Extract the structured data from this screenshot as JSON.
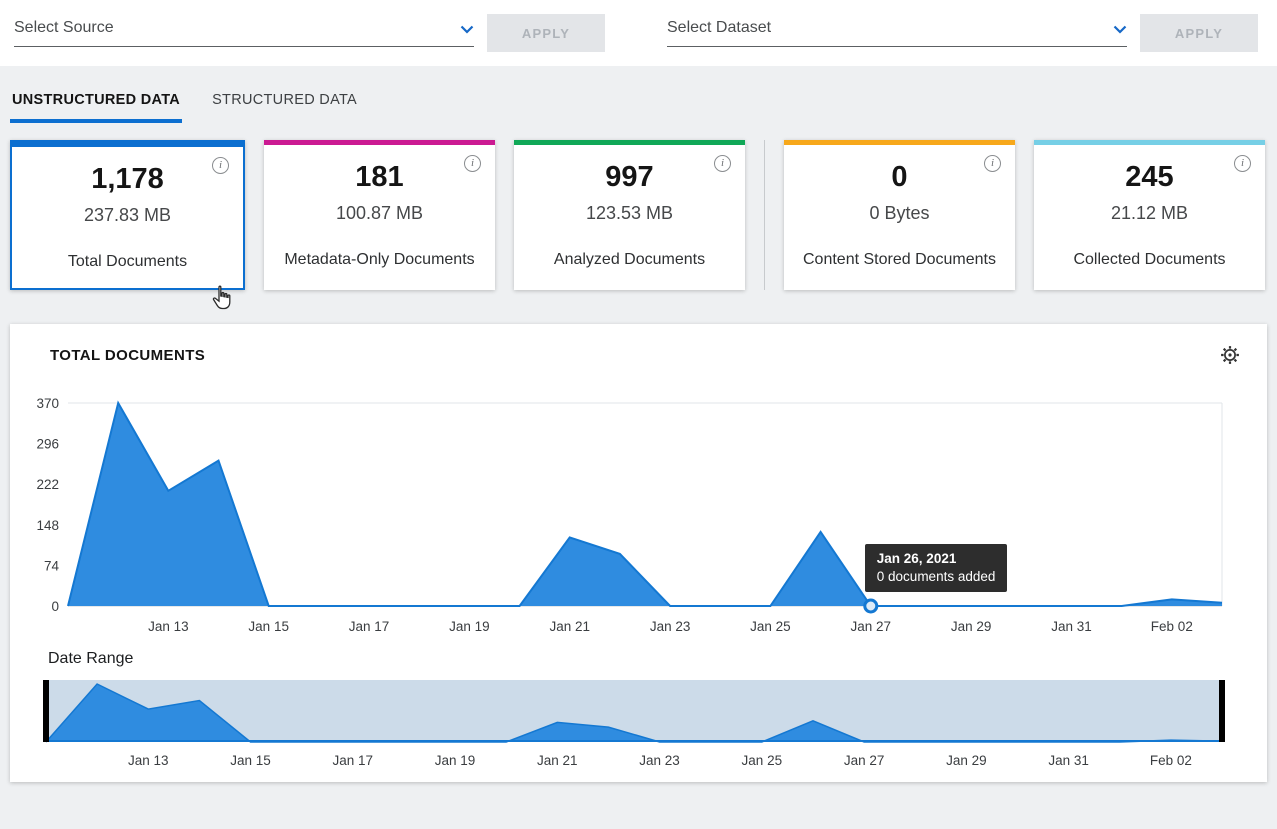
{
  "topbar": {
    "source_select": {
      "label": "Select Source"
    },
    "dataset_select": {
      "label": "Select Dataset"
    },
    "source_apply_label": "APPLY",
    "dataset_apply_label": "APPLY"
  },
  "tabs": {
    "unstructured": {
      "label": "UNSTRUCTURED DATA",
      "active": true
    },
    "structured": {
      "label": "STRUCTURED DATA",
      "active": false
    }
  },
  "cards": [
    {
      "count": "1,178",
      "size": "237.83 MB",
      "label": "Total Documents",
      "accent": "#0c6fd0",
      "selected": true
    },
    {
      "count": "181",
      "size": "100.87 MB",
      "label": "Metadata-Only Documents",
      "accent": "#cb1a92",
      "selected": false
    },
    {
      "count": "997",
      "size": "123.53 MB",
      "label": "Analyzed Documents",
      "accent": "#10a857",
      "selected": false
    },
    {
      "count": "0",
      "size": "0 Bytes",
      "label": "Content Stored Documents",
      "accent": "#f7a81b",
      "selected": false
    },
    {
      "count": "245",
      "size": "21.12 MB",
      "label": "Collected Documents",
      "accent": "#76cfe6",
      "selected": false
    }
  ],
  "panel": {
    "title": "TOTAL DOCUMENTS",
    "date_range_label": "Date Range"
  },
  "tooltip": {
    "title": "Jan 26, 2021",
    "text": "0 documents added"
  },
  "icons": {
    "info_glyph": "i"
  },
  "colors": {
    "accent_blue": "#0c6fd0",
    "chart_fill": "#2f8ce0",
    "chart_line": "#1478d2",
    "navigator_band": "#ccdbe9",
    "navigator_handle": "#000000",
    "tooltip_bg": "#2d2d2d"
  },
  "chart_data": {
    "type": "area",
    "title": "TOTAL DOCUMENTS",
    "x": [
      "Jan 11",
      "Jan 12",
      "Jan 13",
      "Jan 14",
      "Jan 15",
      "Jan 16",
      "Jan 17",
      "Jan 18",
      "Jan 19",
      "Jan 20",
      "Jan 21",
      "Jan 22",
      "Jan 23",
      "Jan 24",
      "Jan 25",
      "Jan 26",
      "Jan 27",
      "Jan 28",
      "Jan 29",
      "Jan 30",
      "Jan 31",
      "Feb 01",
      "Feb 02",
      "Feb 03"
    ],
    "values": [
      0,
      370,
      210,
      265,
      0,
      0,
      0,
      0,
      0,
      0,
      125,
      95,
      0,
      0,
      0,
      135,
      0,
      0,
      0,
      0,
      0,
      0,
      12,
      6
    ],
    "ylabel": "",
    "xlabel": "",
    "ylim": [
      0,
      370
    ],
    "y_ticks": [
      0,
      74,
      148,
      222,
      296,
      370
    ],
    "x_tick_labels": [
      "Jan 13",
      "Jan 15",
      "Jan 17",
      "Jan 19",
      "Jan 21",
      "Jan 23",
      "Jan 25",
      "Jan 27",
      "Jan 29",
      "Jan 31",
      "Feb 02"
    ],
    "grid": "plot border lines only",
    "legend": "none",
    "highlight": {
      "marker_x": "Jan 27",
      "marker_value": 0,
      "tooltip_date": "Jan 26, 2021",
      "tooltip_text": "0 documents added"
    },
    "navigator": {
      "present": true,
      "range_start": "Jan 11",
      "range_end": "Feb 03",
      "x_tick_labels": [
        "Jan 13",
        "Jan 15",
        "Jan 17",
        "Jan 19",
        "Jan 21",
        "Jan 23",
        "Jan 25",
        "Jan 27",
        "Jan 29",
        "Jan 31",
        "Feb 02"
      ]
    }
  }
}
